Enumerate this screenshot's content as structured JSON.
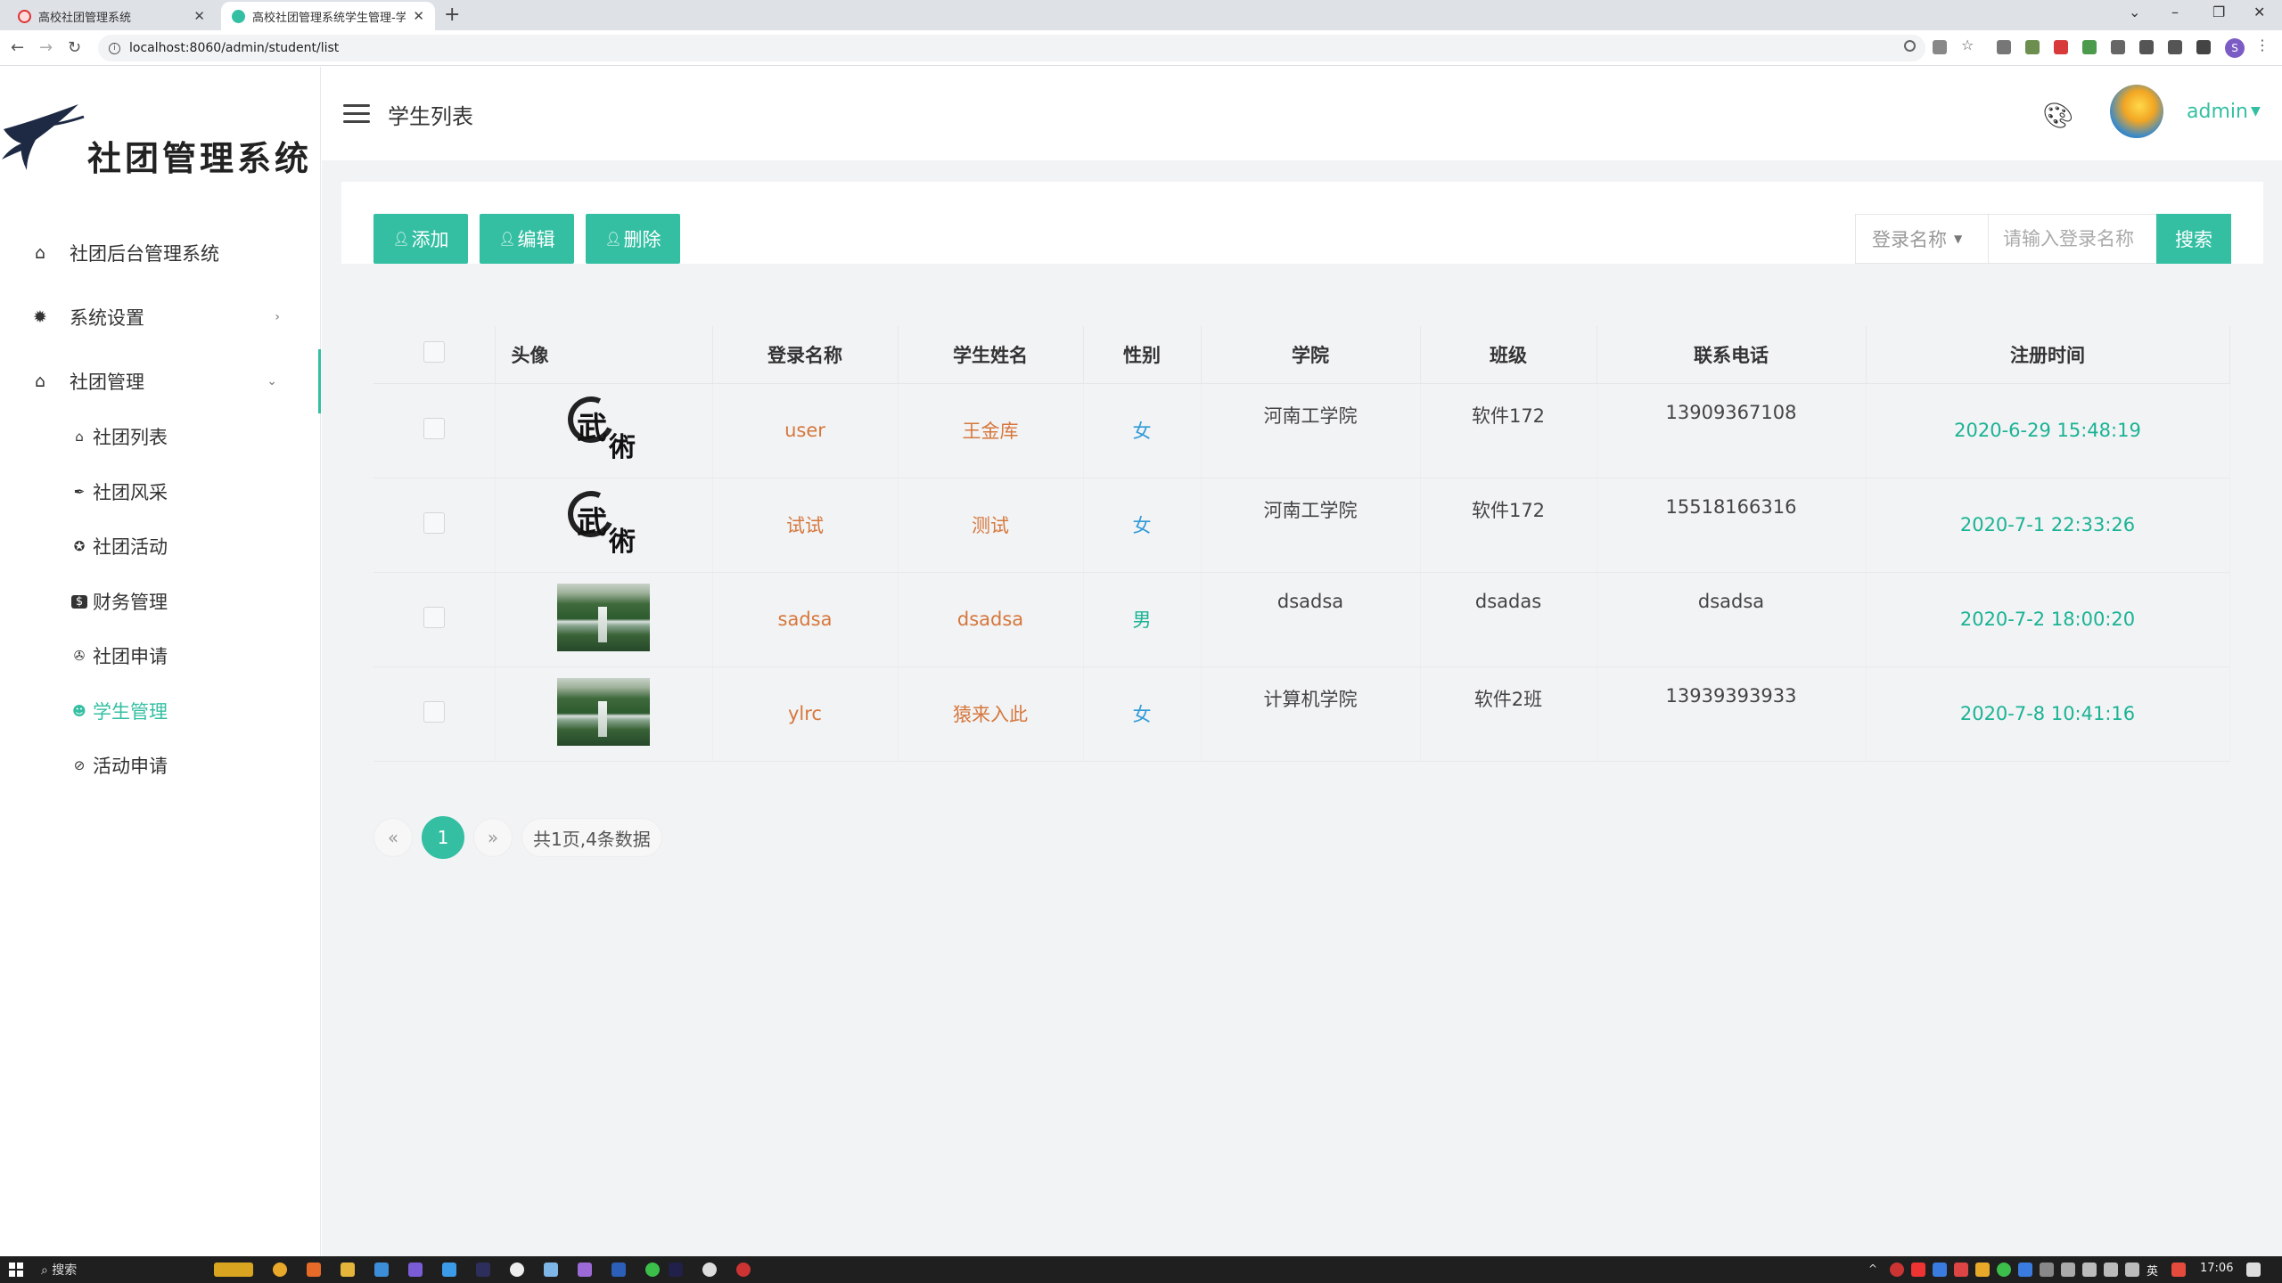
{
  "browser": {
    "tabs": [
      {
        "title": "高校社团管理系统"
      },
      {
        "title": "高校社团管理系统学生管理-学生"
      }
    ],
    "url": "localhost:8060/admin/student/list"
  },
  "sidebar": {
    "logo_text": "社团管理系统",
    "items": [
      {
        "label": "社团后台管理系统",
        "icon": "home-icon"
      },
      {
        "label": "系统设置",
        "icon": "gear-icon"
      },
      {
        "label": "社团管理",
        "icon": "club-icon"
      }
    ],
    "subitems": [
      {
        "label": "社团列表",
        "icon": "home-icon"
      },
      {
        "label": "社团风采",
        "icon": "feather-icon"
      },
      {
        "label": "社团活动",
        "icon": "star-circle-icon"
      },
      {
        "label": "财务管理",
        "icon": "dollar-icon"
      },
      {
        "label": "社团申请",
        "icon": "apply-icon"
      },
      {
        "label": "学生管理",
        "icon": "user-circle-icon"
      },
      {
        "label": "活动申请",
        "icon": "ban-icon"
      }
    ]
  },
  "header": {
    "title": "学生列表",
    "user": "admin"
  },
  "toolbar": {
    "add": "添加",
    "edit": "编辑",
    "delete": "删除",
    "search_field": "登录名称",
    "search_placeholder": "请输入登录名称",
    "search": "搜索"
  },
  "table": {
    "columns": [
      "头像",
      "登录名称",
      "学生姓名",
      "性别",
      "学院",
      "班级",
      "联系电话",
      "注册时间"
    ],
    "rows": [
      {
        "avatar": "ink-calligraphy",
        "login": "user",
        "name": "王金库",
        "gender": "女",
        "college": "河南工学院",
        "class": "软件172",
        "phone": "13909367108",
        "registered": "2020-6-29 15:48:19"
      },
      {
        "avatar": "ink-calligraphy",
        "login": "试试",
        "name": "测试",
        "gender": "女",
        "college": "河南工学院",
        "class": "软件172",
        "phone": "15518166316",
        "registered": "2020-7-1 22:33:26"
      },
      {
        "avatar": "waterfall-photo",
        "login": "sadsa",
        "name": "dsadsa",
        "gender": "男",
        "college": "dsadsa",
        "class": "dsadas",
        "phone": "dsadsa",
        "registered": "2020-7-2 18:00:20"
      },
      {
        "avatar": "waterfall-photo",
        "login": "ylrc",
        "name": "猿来入此",
        "gender": "女",
        "college": "计算机学院",
        "class": "软件2班",
        "phone": "13939393933",
        "registered": "2020-7-8 10:41:16"
      }
    ]
  },
  "pagination": {
    "prev": "«",
    "current": "1",
    "next": "»",
    "summary": "共1页,4条数据"
  },
  "taskbar": {
    "search": "搜索",
    "ime": "英",
    "time": "17:06"
  },
  "colors": {
    "accent": "#34bfa3",
    "login_text": "#d6773c",
    "gender_female": "#2f9bd8",
    "time_text": "#1ab394"
  }
}
